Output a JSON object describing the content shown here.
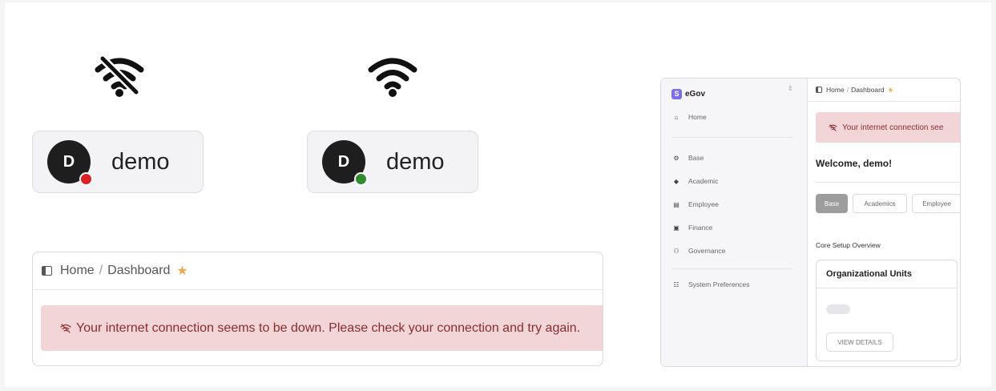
{
  "offline_chip": {
    "avatar_initial": "D",
    "name": "demo",
    "status_color": "#e02020",
    "status": "offline"
  },
  "online_chip": {
    "avatar_initial": "D",
    "name": "demo",
    "status_color": "#2e8b2e",
    "status": "online"
  },
  "icons": {
    "offline": "wifi-off-icon",
    "online": "wifi-icon"
  },
  "colors": {
    "alert_bg": "#f2d6d7",
    "alert_text": "#8a2c2f",
    "star": "#f2a94b",
    "brand": "#7b6cf0"
  },
  "large_card": {
    "breadcrumb": {
      "home": "Home",
      "separator": "/",
      "current": "Dashboard"
    },
    "alert_text": "Your internet connection seems to be down. Please check your connection and try again."
  },
  "app": {
    "brand": {
      "logo": "S",
      "name": "eGov",
      "switcher": "⇕"
    },
    "sidebar": {
      "home": "Home",
      "items": [
        "Base",
        "Academic",
        "Employee",
        "Finance",
        "Governance"
      ],
      "footer": "System Preferences"
    },
    "breadcrumb": {
      "home": "Home",
      "separator": "/",
      "current": "Dashboard"
    },
    "alert_text": "Your internet connection see",
    "welcome": "Welcome, demo!",
    "tabs": [
      "Base",
      "Academics",
      "Employee"
    ],
    "active_tab": "Base",
    "section_label": "Core Setup Overview",
    "card": {
      "title": "Organizational Units",
      "button": "VIEW DETAILS"
    }
  }
}
